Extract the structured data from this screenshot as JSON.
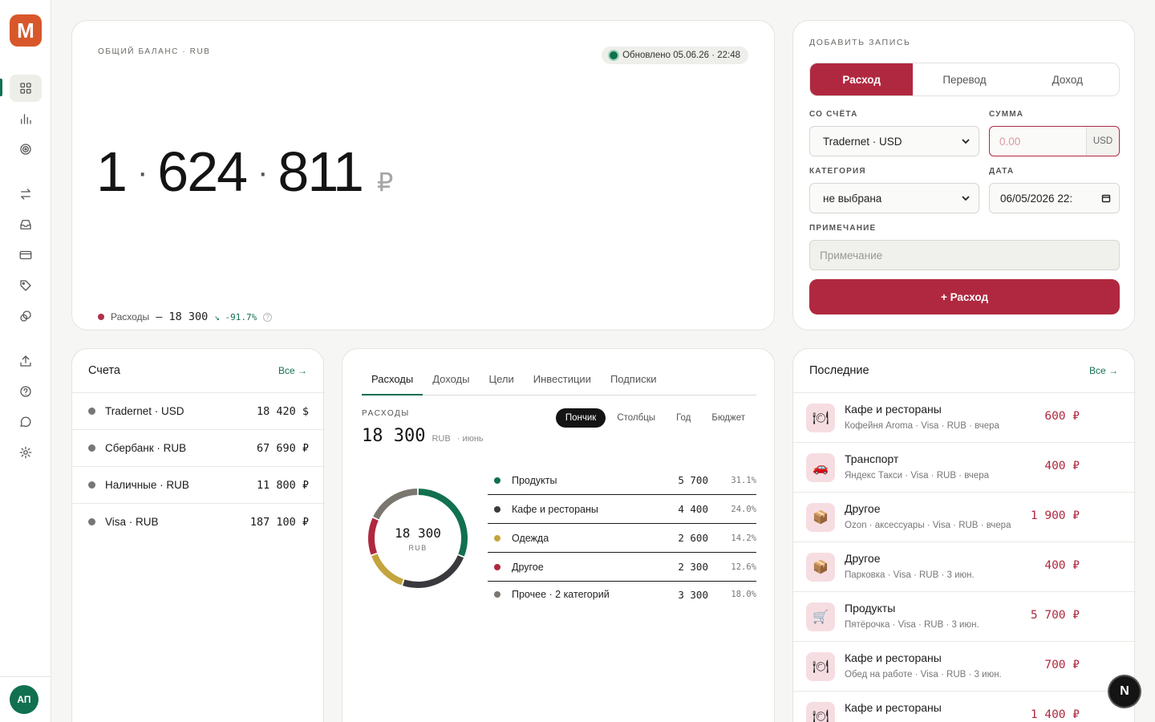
{
  "app": {
    "logo_letter": "M",
    "avatar": "АП",
    "badge": "N"
  },
  "sidebar": {
    "items": [
      {
        "name": "dashboard-icon"
      },
      {
        "name": "chart-icon"
      },
      {
        "name": "target-icon"
      },
      {
        "name": "transfer-icon"
      },
      {
        "name": "inbox-icon"
      },
      {
        "name": "card-icon"
      },
      {
        "name": "tag-icon"
      },
      {
        "name": "coins-icon"
      },
      {
        "name": "upload-icon"
      },
      {
        "name": "help-icon"
      },
      {
        "name": "chat-icon"
      },
      {
        "name": "settings-icon"
      }
    ]
  },
  "balance": {
    "label": "ОБЩИЙ БАЛАНС · RUB",
    "updated": "Обновлено 05.06.26 · 22:48",
    "part1": "1",
    "sep": "·",
    "part2": "624",
    "part3": "811",
    "currency": "₽",
    "expense_label": "Расходы",
    "expense_amount": "– 18 300",
    "expense_change": "↘ -91.7%",
    "help": "?"
  },
  "add_record": {
    "title": "ДОБАВИТЬ ЗАПИСЬ",
    "tabs": [
      "Расход",
      "Перевод",
      "Доход"
    ],
    "account_label": "СО СЧЁТА",
    "account_value": "Tradernet · USD",
    "sum_label": "СУММА",
    "sum_placeholder": "0.00",
    "sum_unit": "USD",
    "category_label": "КАТЕГОРИЯ",
    "category_value": "не выбрана",
    "date_label": "ДАТА",
    "date_value": "06/05/2026 22:",
    "note_label": "ПРИМЕЧАНИЕ",
    "note_placeholder": "Примечание",
    "submit": "+ Расход"
  },
  "accounts": {
    "title": "Счета",
    "link": "Все →",
    "rows": [
      {
        "name": "Tradernet · USD",
        "value": "18 420 $"
      },
      {
        "name": "Сбербанк · RUB",
        "value": "67 690 ₽"
      },
      {
        "name": "Наличные · RUB",
        "value": "11 800 ₽"
      },
      {
        "name": "Visa · RUB",
        "value": "187 100 ₽"
      }
    ]
  },
  "analytics": {
    "tabs": [
      "Расходы",
      "Доходы",
      "Цели",
      "Инвестиции",
      "Подписки"
    ],
    "label": "РАСХОДЫ",
    "total": "18 300",
    "unit": "RUB",
    "period": "· июнь",
    "views": [
      "Пончик",
      "Столбцы",
      "Год",
      "Бюджет"
    ],
    "center_value": "18 300",
    "center_unit": "RUB"
  },
  "chart_data": {
    "type": "pie",
    "donut": true,
    "total": 18300,
    "categories": [
      "Продукты",
      "Кафе и рестораны",
      "Одежда",
      "Другое",
      "Прочее · 2 категорий"
    ],
    "values": [
      5700,
      4400,
      2600,
      2300,
      3300
    ],
    "value_labels": [
      "5 700",
      "4 400",
      "2 600",
      "2 300",
      "3 300"
    ],
    "percent_labels": [
      "31.1%",
      "24.0%",
      "14.2%",
      "12.6%",
      "18.0%"
    ],
    "colors": [
      "#11704f",
      "#3a3a3e",
      "#c4a43c",
      "#b0283f",
      "#7a7670"
    ]
  },
  "recent": {
    "title": "Последние",
    "link": "Все →",
    "rows": [
      {
        "icon": "🍽",
        "title": "Кафе и рестораны",
        "sub": "Кофейня Aroma · Visa · RUB · вчера",
        "amount": "600 ₽"
      },
      {
        "icon": "🚗",
        "title": "Транспорт",
        "sub": "Яндекс Такси · Visa · RUB · вчера",
        "amount": "400 ₽"
      },
      {
        "icon": "📦",
        "title": "Другое",
        "sub": "Ozon · аксессуары · Visa · RUB · вчера",
        "amount": "1 900 ₽"
      },
      {
        "icon": "📦",
        "title": "Другое",
        "sub": "Парковка · Visa · RUB · 3 июн.",
        "amount": "400 ₽"
      },
      {
        "icon": "🛒",
        "title": "Продукты",
        "sub": "Пятёрочка · Visa · RUB · 3 июн.",
        "amount": "5 700 ₽"
      },
      {
        "icon": "🍽",
        "title": "Кафе и рестораны",
        "sub": "Обед на работе · Visa · RUB · 3 июн.",
        "amount": "700 ₽"
      },
      {
        "icon": "🍽",
        "title": "Кафе и рестораны",
        "sub": "",
        "amount": "1 400 ₽"
      }
    ]
  }
}
